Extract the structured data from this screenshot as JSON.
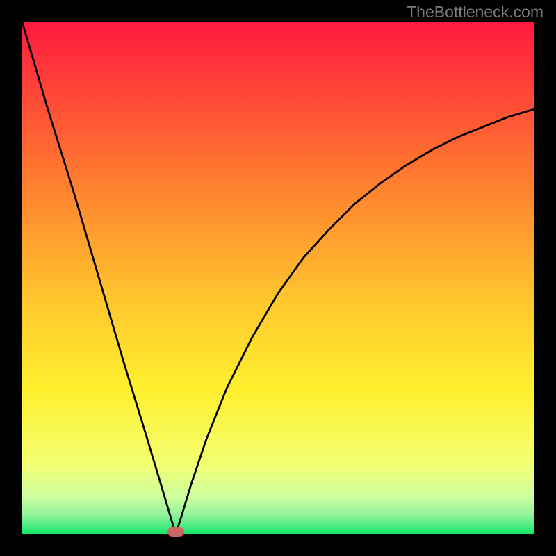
{
  "watermark": "TheBottleneck.com",
  "colors": {
    "background": "#000000",
    "gradient_top": "#ff1a40",
    "gradient_mid1": "#ff6a2f",
    "gradient_mid2": "#ffdd2e",
    "gradient_mid3": "#f7ff6e",
    "gradient_bottom": "#16e86c",
    "curve": "#000000",
    "marker": "#c96767"
  },
  "chart_data": {
    "type": "line",
    "title": "",
    "xlabel": "",
    "ylabel": "",
    "xlim": [
      0,
      100
    ],
    "ylim": [
      0,
      100
    ],
    "x_min_position": 30,
    "marker": {
      "x": 30,
      "y": 0
    },
    "series": [
      {
        "name": "bottleneck-curve",
        "x": [
          0,
          5,
          10,
          15,
          20,
          24,
          27,
          29,
          30,
          31,
          33,
          36,
          40,
          45,
          50,
          55,
          60,
          65,
          70,
          75,
          80,
          85,
          90,
          95,
          100
        ],
        "values": [
          100,
          83,
          67,
          50,
          33,
          20,
          10,
          3.3,
          0,
          3,
          9.6,
          18.5,
          28.5,
          38.5,
          47,
          54,
          59.5,
          64.5,
          68.5,
          72,
          75,
          77.5,
          79.5,
          81.5,
          83
        ]
      }
    ],
    "annotations": []
  }
}
